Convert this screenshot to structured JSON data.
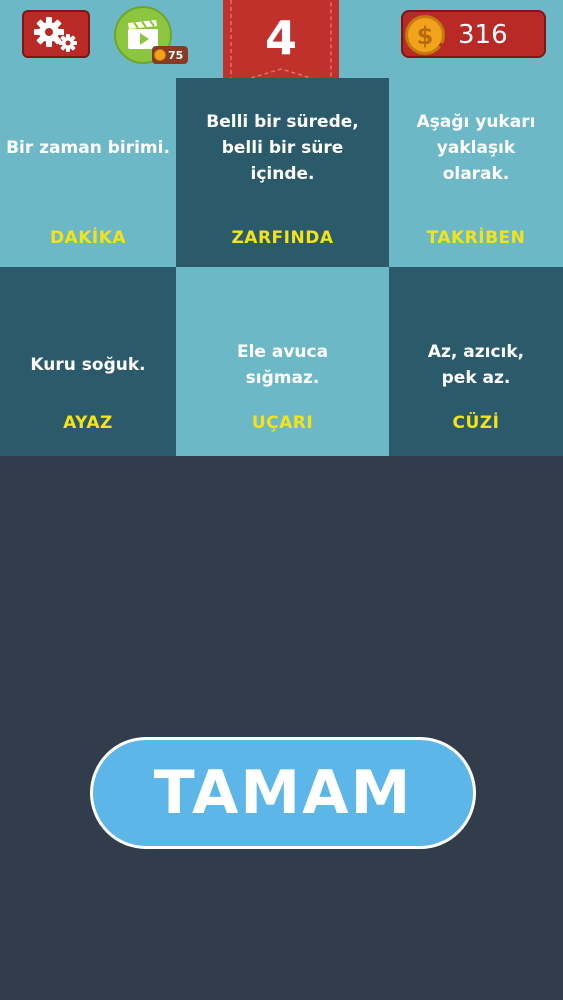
{
  "header": {
    "level": "4",
    "coins": "316",
    "video_cost": "75",
    "icons": {
      "settings": "gears-icon",
      "video": "clapperboard-play-icon",
      "coin": "dollar-coin-icon"
    },
    "colors": {
      "bar": "#6db8c7",
      "red": "#b92a26",
      "green": "#8cc63f",
      "gold": "#f2a31b"
    }
  },
  "tiles": [
    {
      "clue": "Bir zaman birimi.",
      "answer": "DAKİKA"
    },
    {
      "clue": "Belli bir sürede, belli bir süre içinde.",
      "answer": "ZARFINDA"
    },
    {
      "clue": "Aşağı yukarı yaklaşık olarak.",
      "answer": "TAKRİBEN"
    },
    {
      "clue": "Kuru soğuk.",
      "answer": "AYAZ"
    },
    {
      "clue": "Ele avuca sığmaz.",
      "answer": "UÇARI"
    },
    {
      "clue": "Az, azıcık, pek az.",
      "answer": "CÜZİ"
    }
  ],
  "ok_button": {
    "label": "TAMAM",
    "color": "#5db6e8"
  },
  "colors": {
    "tile_light": "#6db8c7",
    "tile_dark": "#2b5a6b",
    "answer_text": "#f2e31a",
    "background": "#323d4c"
  }
}
